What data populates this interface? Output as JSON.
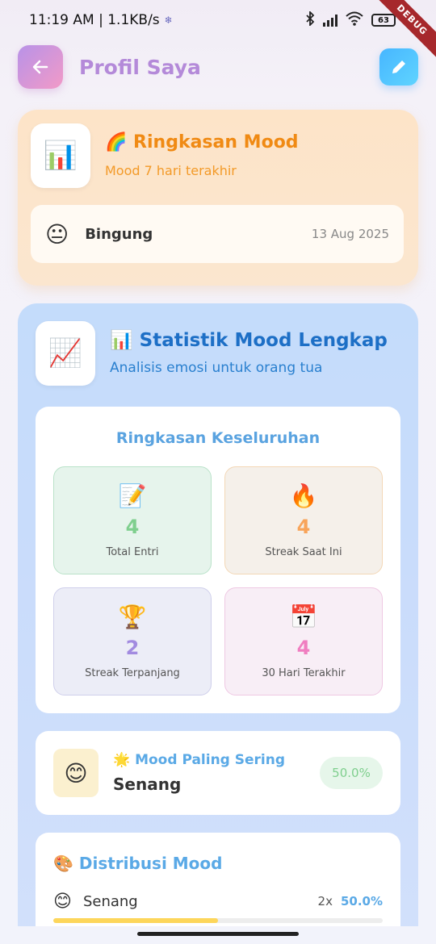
{
  "status_bar": {
    "time_speed": "11:19 AM | 1.1KB/s",
    "snowflake": "❄",
    "battery": "63",
    "debug_label": "DEBUG"
  },
  "header": {
    "back_icon": "arrow-left-icon",
    "title": "Profil Saya",
    "edit_icon": "pencil-icon"
  },
  "mood_summary": {
    "icon": "📊",
    "title": "🌈 Ringkasan Mood",
    "subtitle": "Mood 7 hari terakhir",
    "recent": {
      "emoji": "😐",
      "label": "Bingung",
      "date": "13 Aug 2025"
    }
  },
  "stats": {
    "icon": "📈",
    "title": "📊 Statistik Mood Lengkap",
    "subtitle": "Analisis emosi untuk orang tua",
    "overall": {
      "title": "Ringkasan Keseluruhan",
      "tiles": [
        {
          "icon": "📝",
          "value": "4",
          "label": "Total Entri"
        },
        {
          "icon": "🔥",
          "value": "4",
          "label": "Streak Saat Ini"
        },
        {
          "icon": "🏆",
          "value": "2",
          "label": "Streak Terpanjang"
        },
        {
          "icon": "📅",
          "value": "4",
          "label": "30 Hari Terakhir"
        }
      ]
    },
    "most_frequent": {
      "emoji": "😊",
      "title": "🌟 Mood Paling Sering",
      "mood": "Senang",
      "percent": "50.0%"
    },
    "distribution": {
      "title": "🎨 Distribusi Mood",
      "rows": [
        {
          "emoji": "😊",
          "name": "Senang",
          "count": "2x",
          "percent": "50.0%",
          "fraction": 0.5
        }
      ]
    }
  }
}
